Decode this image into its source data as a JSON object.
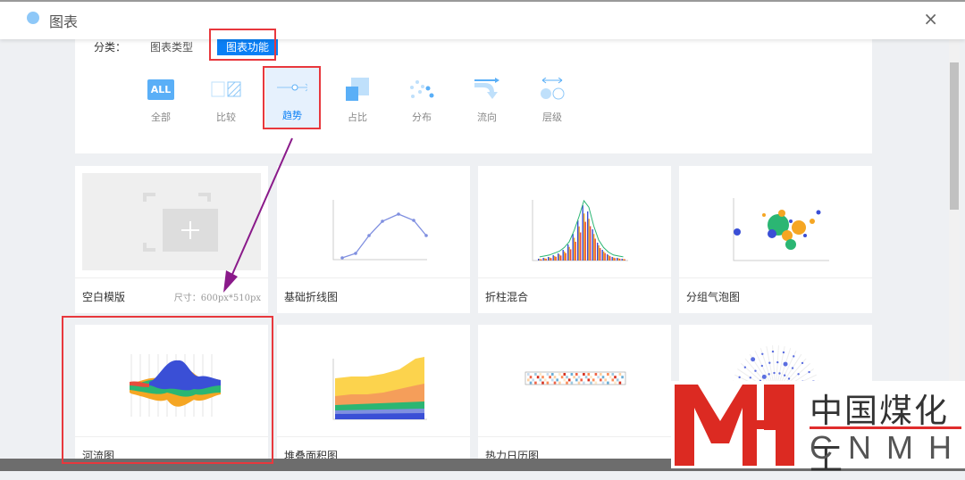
{
  "header": {
    "title": "图表",
    "close": "×"
  },
  "filter": {
    "label": "分类：",
    "options": [
      "图表类型",
      "图表功能"
    ],
    "functions": [
      {
        "label": "全部",
        "icon": "all-icon"
      },
      {
        "label": "比较",
        "icon": "compare-icon"
      },
      {
        "label": "趋势",
        "icon": "trend-icon"
      },
      {
        "label": "占比",
        "icon": "proportion-icon"
      },
      {
        "label": "分布",
        "icon": "distribution-icon"
      },
      {
        "label": "流向",
        "icon": "flow-icon"
      },
      {
        "label": "层级",
        "icon": "hierarchy-icon"
      }
    ],
    "all_text": "ALL"
  },
  "cards": [
    {
      "name": "空白模版",
      "size": "尺寸：600px*510px"
    },
    {
      "name": "基础折线图"
    },
    {
      "name": "折柱混合"
    },
    {
      "name": "分组气泡图"
    },
    {
      "name": "河流图"
    },
    {
      "name": "堆叠面积图"
    },
    {
      "name": "热力日历图"
    },
    {
      "name": ""
    }
  ],
  "watermark": {
    "cn": "中国煤化工",
    "en": "CNMHG"
  },
  "colors": {
    "accent": "#0a7ff5",
    "highlight": "#e8383d",
    "arrow": "#8a1a8a"
  }
}
